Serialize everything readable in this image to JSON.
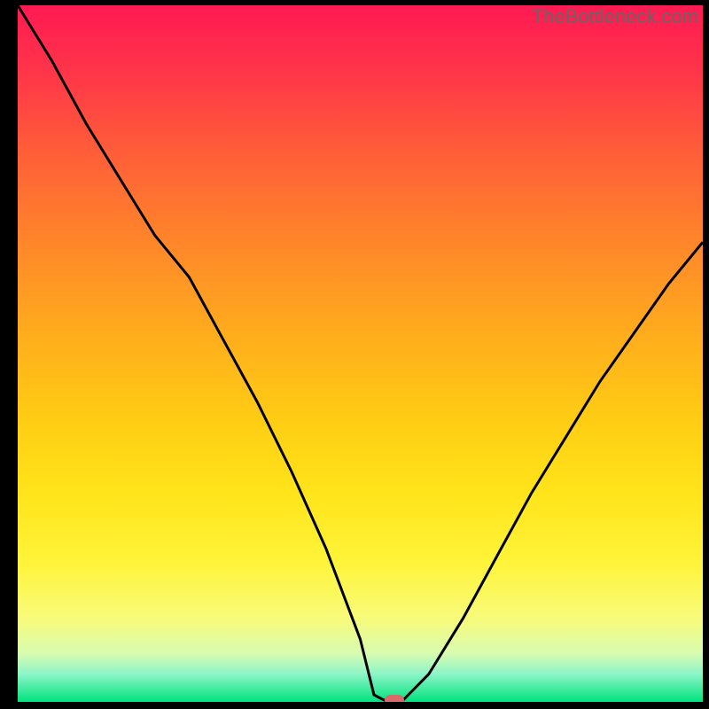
{
  "watermark": "TheBottleneck.com",
  "chart_data": {
    "type": "line",
    "title": "",
    "xlabel": "",
    "ylabel": "",
    "xlim": [
      0,
      100
    ],
    "ylim": [
      0,
      100
    ],
    "series": [
      {
        "name": "curve",
        "x": [
          0,
          5,
          10,
          15,
          20,
          25,
          30,
          35,
          40,
          45,
          50,
          52,
          54,
          56,
          60,
          65,
          70,
          75,
          80,
          85,
          90,
          95,
          100
        ],
        "y": [
          100,
          92,
          83,
          75,
          67,
          61,
          52,
          43,
          33,
          22,
          9,
          1,
          0,
          0,
          4,
          12,
          21,
          30,
          38,
          46,
          53,
          60,
          66
        ]
      }
    ],
    "marker": {
      "x": 55,
      "y": 0
    },
    "gradient_stops": [
      {
        "pos": 0.0,
        "color": "#ff1a53"
      },
      {
        "pos": 0.5,
        "color": "#ffb41a"
      },
      {
        "pos": 0.8,
        "color": "#fff43a"
      },
      {
        "pos": 1.0,
        "color": "#00e37d"
      }
    ]
  }
}
